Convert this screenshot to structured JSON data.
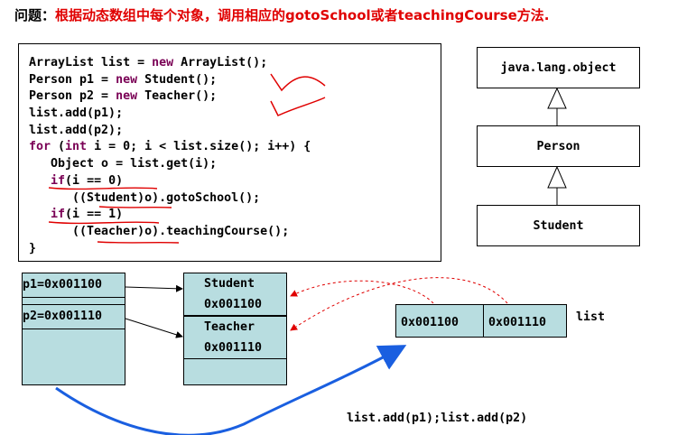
{
  "question": {
    "label": "问题：",
    "text": "根据动态数组中每个对象，调用相应的gotoSchool或者teachingCourse方法."
  },
  "code_lines": [
    [
      "",
      "ArrayList list = ",
      "new",
      " ArrayList();"
    ],
    [
      "",
      "Person p1 = ",
      "new",
      " Student();"
    ],
    [
      "",
      "Person p2 = ",
      "new",
      " Teacher();"
    ],
    [
      "",
      "list.add(p1);",
      "",
      ""
    ],
    [
      "",
      "list.add(p2);",
      "",
      ""
    ],
    [
      "for",
      " (",
      "int",
      " i = 0; i < list.size(); i++) {"
    ],
    [
      "",
      "   Object o = list.get(i);",
      "",
      ""
    ],
    [
      "   if",
      "(i == 0)",
      "",
      ""
    ],
    [
      "",
      "      ((Student)o).gotoSchool();",
      "",
      ""
    ],
    [
      "   if",
      "(i == 1)",
      "",
      ""
    ],
    [
      "",
      "      ((Teacher)o).teachingCourse();",
      "",
      ""
    ],
    [
      "",
      "}",
      "",
      ""
    ]
  ],
  "uml": {
    "object": "java.lang.object",
    "person": "Person",
    "student": "Student"
  },
  "stack": {
    "p1": "p1=0x001100",
    "p2": "p2=0x001110"
  },
  "heap": {
    "student_label": "Student",
    "student_addr": "0x001100",
    "teacher_label": "Teacher",
    "teacher_addr": "0x001110"
  },
  "list_box": {
    "cell0": "0x001100",
    "cell1": "0x001110",
    "label": "list"
  },
  "caption": "list.add(p1);list.add(p2)",
  "colors": {
    "cell_fill": "#b8dde0",
    "question_text": "#e00000",
    "keyword": "#7a0055",
    "annotation_red": "#e00000",
    "arrow_blue": "#1a5fe0"
  }
}
